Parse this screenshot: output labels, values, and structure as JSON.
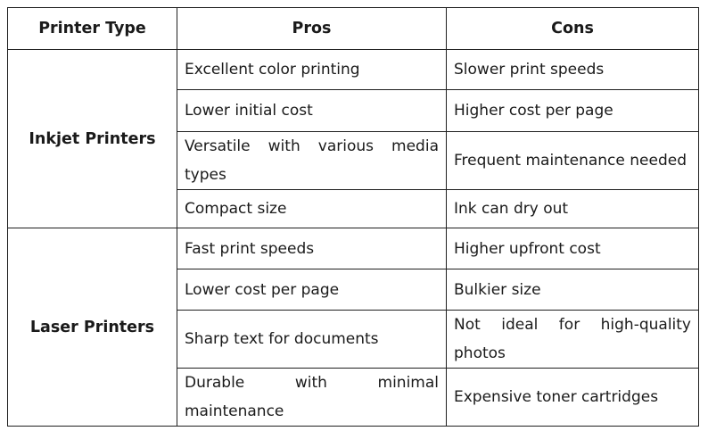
{
  "table": {
    "headers": [
      "Printer Type",
      "Pros",
      "Cons"
    ],
    "groups": [
      {
        "type": "Inkjet Printers",
        "rows": [
          {
            "pro": "Excellent color printing",
            "con": "Slower print speeds"
          },
          {
            "pro": "Lower initial cost",
            "con": "Higher cost per page"
          },
          {
            "pro": "Versatile with various media types",
            "con": "Frequent maintenance needed"
          },
          {
            "pro": "Compact size",
            "con": "Ink can dry out"
          }
        ]
      },
      {
        "type": "Laser Printers",
        "rows": [
          {
            "pro": "Fast print speeds",
            "con": "Higher upfront cost"
          },
          {
            "pro": "Lower cost per page",
            "con": "Bulkier size"
          },
          {
            "pro": "Sharp text for documents",
            "con": "Not ideal for high-quality photos"
          },
          {
            "pro": "Durable with minimal maintenance",
            "con": "Expensive toner cartridges"
          }
        ]
      }
    ]
  }
}
